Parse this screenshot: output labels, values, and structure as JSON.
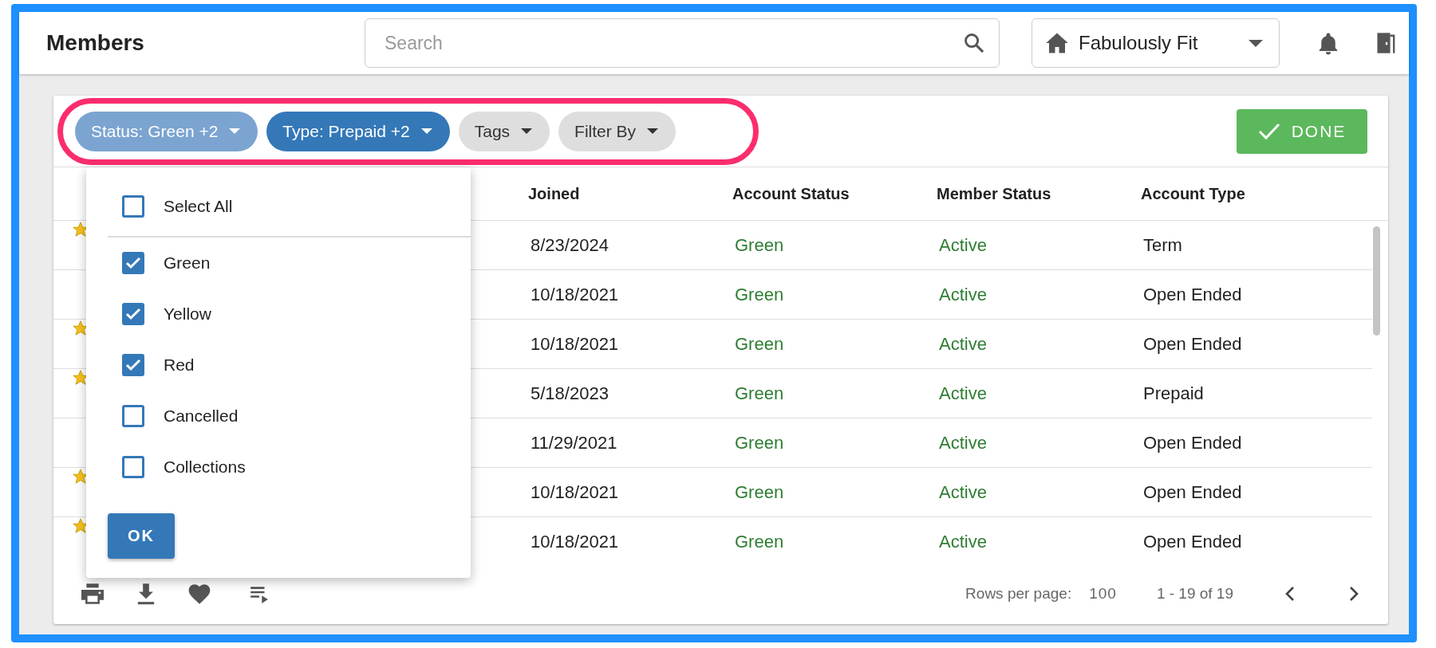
{
  "header": {
    "title": "Members",
    "search": {
      "placeholder": "Search"
    },
    "location": "Fabulously Fit"
  },
  "filters": [
    {
      "label": "Status: Green +2",
      "active": true,
      "open": true
    },
    {
      "label": "Type: Prepaid +2",
      "active": true,
      "open": false
    },
    {
      "label": "Tags",
      "active": false,
      "open": false
    },
    {
      "label": "Filter By",
      "active": false,
      "open": false
    }
  ],
  "done_button": "DONE",
  "table": {
    "columns": [
      "Joined",
      "Account Status",
      "Member Status",
      "Account Type"
    ],
    "rows": [
      {
        "favorite": true,
        "joined": "8/23/2024",
        "account_status": "Green",
        "member_status": "Active",
        "account_type": "Term"
      },
      {
        "favorite": false,
        "joined": "10/18/2021",
        "account_status": "Green",
        "member_status": "Active",
        "account_type": "Open Ended"
      },
      {
        "favorite": true,
        "joined": "10/18/2021",
        "account_status": "Green",
        "member_status": "Active",
        "account_type": "Open Ended"
      },
      {
        "favorite": true,
        "joined": "5/18/2023",
        "account_status": "Green",
        "member_status": "Active",
        "account_type": "Prepaid"
      },
      {
        "favorite": false,
        "joined": "11/29/2021",
        "account_status": "Green",
        "member_status": "Active",
        "account_type": "Open Ended"
      },
      {
        "favorite": true,
        "joined": "10/18/2021",
        "account_status": "Green",
        "member_status": "Active",
        "account_type": "Open Ended"
      },
      {
        "favorite": true,
        "joined": "10/18/2021",
        "account_status": "Green",
        "member_status": "Active",
        "account_type": "Open Ended"
      }
    ]
  },
  "status_menu": {
    "select_all": {
      "label": "Select All",
      "checked": false
    },
    "options": [
      {
        "label": "Green",
        "checked": true
      },
      {
        "label": "Yellow",
        "checked": true
      },
      {
        "label": "Red",
        "checked": true
      },
      {
        "label": "Cancelled",
        "checked": false
      },
      {
        "label": "Collections",
        "checked": false
      }
    ],
    "ok_button": "OK"
  },
  "footer": {
    "rows_per_page_label": "Rows per page:",
    "rows_per_page": "100",
    "range": "1 - 19 of 19"
  }
}
